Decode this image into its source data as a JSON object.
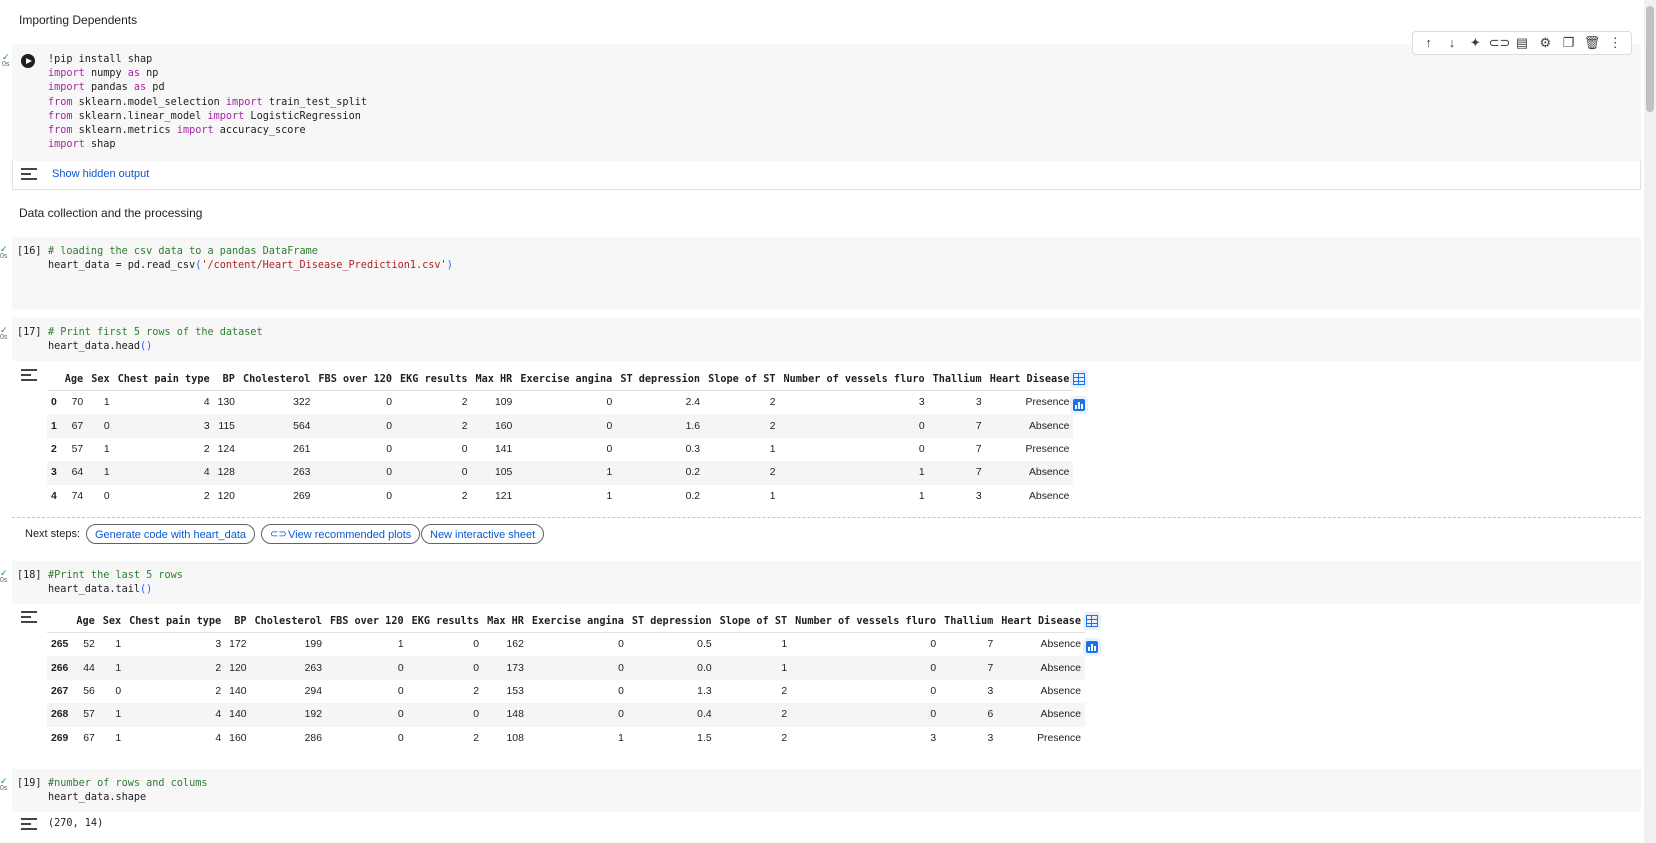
{
  "md": {
    "importing": "Importing Dependents",
    "data_collection": "Data collection and the processing"
  },
  "cell1": {
    "gutter": "0s",
    "lines": [
      [
        {
          "t": "!pip install shap",
          "c": ""
        }
      ],
      [
        {
          "t": "import",
          "c": "kw"
        },
        {
          "t": " numpy ",
          "c": ""
        },
        {
          "t": "as",
          "c": "kw"
        },
        {
          "t": " np",
          "c": ""
        }
      ],
      [
        {
          "t": "import",
          "c": "kw"
        },
        {
          "t": " pandas ",
          "c": ""
        },
        {
          "t": "as",
          "c": "kw"
        },
        {
          "t": " pd",
          "c": ""
        }
      ],
      [
        {
          "t": "from",
          "c": "kw"
        },
        {
          "t": " sklearn.model_selection ",
          "c": ""
        },
        {
          "t": "import",
          "c": "kw"
        },
        {
          "t": " train_test_split",
          "c": ""
        }
      ],
      [
        {
          "t": "from",
          "c": "kw"
        },
        {
          "t": " sklearn.linear_model ",
          "c": ""
        },
        {
          "t": "import",
          "c": "kw"
        },
        {
          "t": " LogisticRegression",
          "c": ""
        }
      ],
      [
        {
          "t": "from",
          "c": "kw"
        },
        {
          "t": " sklearn.metrics ",
          "c": ""
        },
        {
          "t": "import",
          "c": "kw"
        },
        {
          "t": " accuracy_score",
          "c": ""
        }
      ],
      [
        {
          "t": "import",
          "c": "kw"
        },
        {
          "t": " shap",
          "c": ""
        }
      ]
    ],
    "show_hidden": "Show hidden output"
  },
  "cell16": {
    "count": "[16]",
    "gutter": "0s",
    "lines": [
      [
        {
          "t": "# loading the csv data to a pandas DataFrame",
          "c": "cm"
        }
      ],
      [
        {
          "t": "heart_data = pd.read_csv",
          "c": ""
        },
        {
          "t": "(",
          "c": "pl"
        },
        {
          "t": "'/content/Heart_Disease_Prediction1.csv'",
          "c": "st"
        },
        {
          "t": ")",
          "c": "pl"
        }
      ]
    ]
  },
  "cell17": {
    "count": "[17]",
    "gutter": "0s",
    "lines": [
      [
        {
          "t": "# Print first 5 rows of the dataset",
          "c": "cm"
        }
      ],
      [
        {
          "t": "heart_data.head",
          "c": ""
        },
        {
          "t": "()",
          "c": "pl"
        }
      ]
    ]
  },
  "cell18": {
    "count": "[18]",
    "gutter": "0s",
    "lines": [
      [
        {
          "t": "#Print the last 5 rows",
          "c": "cm"
        }
      ],
      [
        {
          "t": "heart_data.tail",
          "c": ""
        },
        {
          "t": "()",
          "c": "pl"
        }
      ]
    ]
  },
  "cell19": {
    "count": "[19]",
    "gutter": "0s",
    "lines": [
      [
        {
          "t": "#number of rows and colums",
          "c": "cm"
        }
      ],
      [
        {
          "t": "heart_data.shape",
          "c": ""
        }
      ]
    ],
    "output": "(270, 14)"
  },
  "columns": [
    "",
    "Age",
    "Sex",
    "Chest pain type",
    "BP",
    "Cholesterol",
    "FBS over 120",
    "EKG results",
    "Max HR",
    "Exercise angina",
    "ST depression",
    "Slope of ST",
    "Number of vessels fluro",
    "Thallium",
    "Heart Disease"
  ],
  "head_rows": [
    [
      "0",
      "70",
      "1",
      "4",
      "130",
      "322",
      "0",
      "2",
      "109",
      "0",
      "2.4",
      "2",
      "3",
      "3",
      "Presence"
    ],
    [
      "1",
      "67",
      "0",
      "3",
      "115",
      "564",
      "0",
      "2",
      "160",
      "0",
      "1.6",
      "2",
      "0",
      "7",
      "Absence"
    ],
    [
      "2",
      "57",
      "1",
      "2",
      "124",
      "261",
      "0",
      "0",
      "141",
      "0",
      "0.3",
      "1",
      "0",
      "7",
      "Presence"
    ],
    [
      "3",
      "64",
      "1",
      "4",
      "128",
      "263",
      "0",
      "0",
      "105",
      "1",
      "0.2",
      "2",
      "1",
      "7",
      "Absence"
    ],
    [
      "4",
      "74",
      "0",
      "2",
      "120",
      "269",
      "0",
      "2",
      "121",
      "1",
      "0.2",
      "1",
      "1",
      "3",
      "Absence"
    ]
  ],
  "tail_rows": [
    [
      "265",
      "52",
      "1",
      "3",
      "172",
      "199",
      "1",
      "0",
      "162",
      "0",
      "0.5",
      "1",
      "0",
      "7",
      "Absence"
    ],
    [
      "266",
      "44",
      "1",
      "2",
      "120",
      "263",
      "0",
      "0",
      "173",
      "0",
      "0.0",
      "1",
      "0",
      "7",
      "Absence"
    ],
    [
      "267",
      "56",
      "0",
      "2",
      "140",
      "294",
      "0",
      "2",
      "153",
      "0",
      "1.3",
      "2",
      "0",
      "3",
      "Absence"
    ],
    [
      "268",
      "57",
      "1",
      "4",
      "140",
      "192",
      "0",
      "0",
      "148",
      "0",
      "0.4",
      "2",
      "0",
      "6",
      "Absence"
    ],
    [
      "269",
      "67",
      "1",
      "4",
      "160",
      "286",
      "0",
      "2",
      "108",
      "1",
      "1.5",
      "2",
      "3",
      "3",
      "Presence"
    ]
  ],
  "next_steps": {
    "label": "Next steps:",
    "chips": [
      "Generate code with heart_data",
      "View recommended plots",
      "New interactive sheet"
    ]
  }
}
